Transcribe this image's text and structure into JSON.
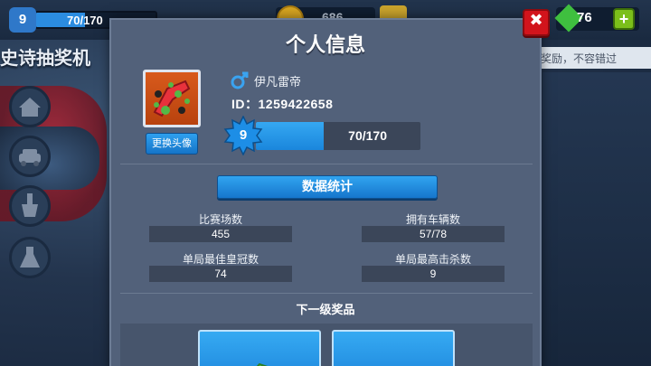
{
  "hud": {
    "level": "9",
    "xp_text": "70/170",
    "xp_progress": 0.41,
    "coins_text": "686",
    "gems_text": "76",
    "gems_plus": "+",
    "left_title": "史诗抽奖机",
    "notice_text": "奖励，不容错过"
  },
  "close_button": {
    "label": "✖"
  },
  "modal": {
    "title": "个人信息",
    "change_avatar_label": "更换头像",
    "gender_icon": "male-icon",
    "player_name": "伊凡雷帝",
    "player_id": "ID：1259422658",
    "level": "9",
    "xp_text": "70/170",
    "xp_progress": 0.41,
    "stats_title": "数据统计",
    "stats": [
      {
        "label": "比赛场数",
        "value": "455"
      },
      {
        "label": "拥有车辆数",
        "value": "57/78"
      },
      {
        "label": "单局最佳皇冠数",
        "value": "74"
      },
      {
        "label": "单局最高击杀数",
        "value": "9"
      }
    ],
    "next_reward_title": "下一级奖品",
    "rewards": [
      {
        "icon": "green-gem-reward-icon"
      },
      {
        "icon": "car-reward-icon"
      }
    ]
  },
  "colors": {
    "modal_bg": "#52617a",
    "accent_blue": "#1a86dc",
    "close_red": "#d2141c"
  }
}
